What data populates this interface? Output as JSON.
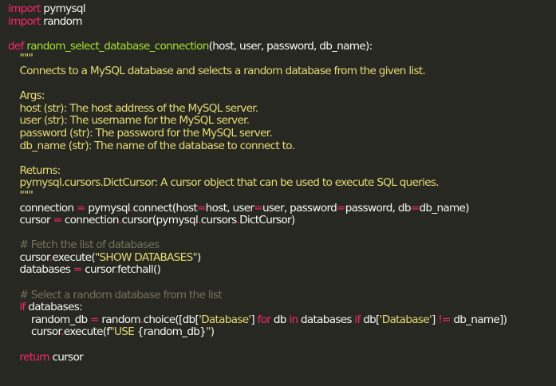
{
  "theme": {
    "background": "#272822",
    "plain": "#f8f8f2",
    "keyword": "#f92672",
    "function_name": "#a6e22e",
    "string": "#e6db74",
    "comment": "#75715e"
  },
  "code": {
    "lines": [
      [
        [
          "kw",
          "import"
        ],
        [
          "tx",
          " pymysql"
        ]
      ],
      [
        [
          "kw",
          "import"
        ],
        [
          "tx",
          " random"
        ]
      ],
      [],
      [
        [
          "kw",
          "def"
        ],
        [
          "tx",
          " "
        ],
        [
          "fn",
          "random_select_database_connection"
        ],
        [
          "tx",
          "(host, user, password, db_name):"
        ]
      ],
      [
        [
          "str",
          "    \"\"\""
        ]
      ],
      [
        [
          "str",
          "    Connects to a MySQL database and selects a random database from the given list."
        ]
      ],
      [],
      [
        [
          "str",
          "    Args:"
        ]
      ],
      [
        [
          "str",
          "    host (str): The host address of the MySQL server."
        ]
      ],
      [
        [
          "str",
          "    user (str): The username for the MySQL server."
        ]
      ],
      [
        [
          "str",
          "    password (str): The password for the MySQL server."
        ]
      ],
      [
        [
          "str",
          "    db_name (str): The name of the database to connect to."
        ]
      ],
      [],
      [
        [
          "str",
          "    Returns:"
        ]
      ],
      [
        [
          "str",
          "    pymysql.cursors.DictCursor: A cursor object that can be used to execute SQL queries."
        ]
      ],
      [
        [
          "str",
          "    \"\"\""
        ]
      ],
      [
        [
          "tx",
          "    connection "
        ],
        [
          "op",
          "="
        ],
        [
          "tx",
          " pymysql"
        ],
        [
          "dot",
          "."
        ],
        [
          "tx",
          "connect(host"
        ],
        [
          "op",
          "="
        ],
        [
          "tx",
          "host, user"
        ],
        [
          "op",
          "="
        ],
        [
          "tx",
          "user, password"
        ],
        [
          "op",
          "="
        ],
        [
          "tx",
          "password, db"
        ],
        [
          "op",
          "="
        ],
        [
          "tx",
          "db_name)"
        ]
      ],
      [
        [
          "tx",
          "    cursor "
        ],
        [
          "op",
          "="
        ],
        [
          "tx",
          " connection"
        ],
        [
          "dot",
          "."
        ],
        [
          "tx",
          "cursor(pymysql"
        ],
        [
          "dot",
          "."
        ],
        [
          "tx",
          "cursors"
        ],
        [
          "dot",
          "."
        ],
        [
          "tx",
          "DictCursor)"
        ]
      ],
      [],
      [
        [
          "cm",
          "    # Fetch the list of databases"
        ]
      ],
      [
        [
          "tx",
          "    cursor"
        ],
        [
          "dot",
          "."
        ],
        [
          "tx",
          "execute("
        ],
        [
          "str",
          "\"SHOW DATABASES\""
        ],
        [
          "tx",
          ")"
        ]
      ],
      [
        [
          "tx",
          "    databases "
        ],
        [
          "op",
          "="
        ],
        [
          "tx",
          " cursor"
        ],
        [
          "dot",
          "."
        ],
        [
          "tx",
          "fetchall()"
        ]
      ],
      [],
      [
        [
          "cm",
          "    # Select a random database from the list"
        ]
      ],
      [
        [
          "tx",
          "    "
        ],
        [
          "kw",
          "if"
        ],
        [
          "tx",
          " databases:"
        ]
      ],
      [
        [
          "tx",
          "        random_db "
        ],
        [
          "op",
          "="
        ],
        [
          "tx",
          " random"
        ],
        [
          "dot",
          "."
        ],
        [
          "tx",
          "choice([db["
        ],
        [
          "str",
          "'Database'"
        ],
        [
          "tx",
          "] "
        ],
        [
          "kw",
          "for"
        ],
        [
          "tx",
          " db "
        ],
        [
          "kw",
          "in"
        ],
        [
          "tx",
          " databases "
        ],
        [
          "kw",
          "if"
        ],
        [
          "tx",
          " db["
        ],
        [
          "str",
          "'Database'"
        ],
        [
          "tx",
          "] "
        ],
        [
          "op",
          "!="
        ],
        [
          "tx",
          " db_name])"
        ]
      ],
      [
        [
          "tx",
          "        cursor"
        ],
        [
          "dot",
          "."
        ],
        [
          "tx",
          "execute(f"
        ],
        [
          "str",
          "\"USE "
        ],
        [
          "tx",
          "{random_db}"
        ],
        [
          "str",
          "\""
        ],
        [
          "tx",
          ")"
        ]
      ],
      [],
      [
        [
          "tx",
          "    "
        ],
        [
          "kw",
          "return"
        ],
        [
          "tx",
          " cursor"
        ]
      ]
    ]
  }
}
